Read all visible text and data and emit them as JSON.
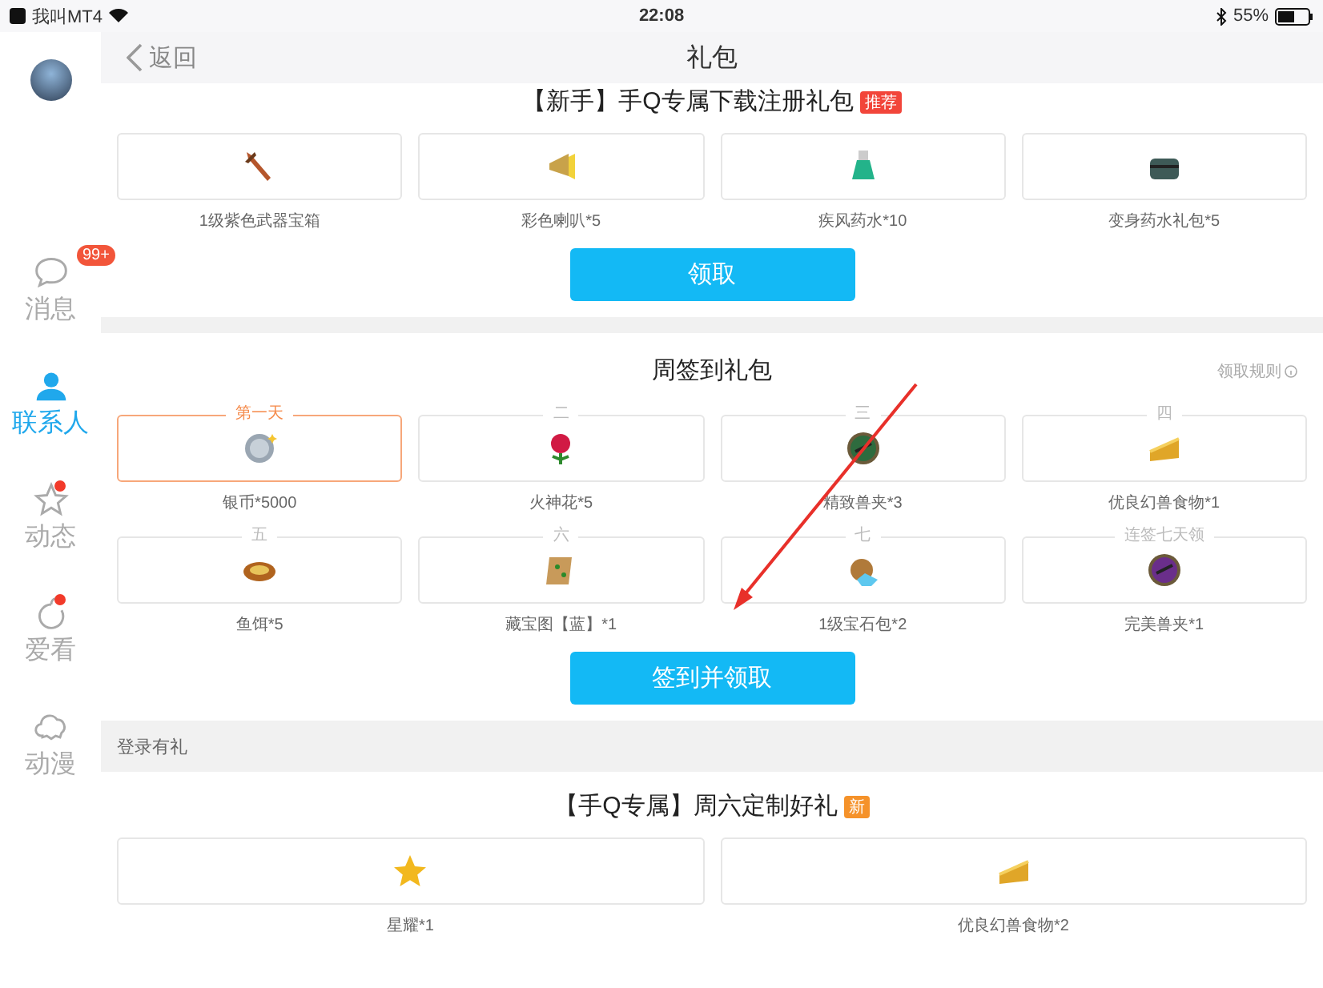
{
  "status_bar": {
    "back_app": "我叫MT4",
    "time": "22:08",
    "battery": "55%"
  },
  "sidebar": {
    "items": [
      {
        "label": "消息",
        "selected": false,
        "badge": "99+",
        "dot": false
      },
      {
        "label": "联系人",
        "selected": true,
        "dot": false
      },
      {
        "label": "动态",
        "selected": false,
        "dot": true
      },
      {
        "label": "爱看",
        "selected": false,
        "dot": true
      },
      {
        "label": "动漫",
        "selected": false,
        "dot": false
      }
    ]
  },
  "nav": {
    "back": "返回",
    "title": "礼包"
  },
  "newbie_pack": {
    "title": "【新手】手Q专属下载注册礼包",
    "tag": "推荐",
    "rewards": [
      {
        "name": "1级紫色武器宝箱"
      },
      {
        "name": "彩色喇叭*5"
      },
      {
        "name": "疾风药水*10"
      },
      {
        "name": "变身药水礼包*5"
      }
    ],
    "button": "领取"
  },
  "weekly_pack": {
    "title": "周签到礼包",
    "rules_link": "领取规则",
    "rewards": [
      {
        "day": "第一天",
        "name": "银币*5000",
        "selected": true
      },
      {
        "day": "二",
        "name": "火神花*5",
        "selected": false
      },
      {
        "day": "三",
        "name": "精致兽夹*3",
        "selected": false
      },
      {
        "day": "四",
        "name": "优良幻兽食物*1",
        "selected": false
      },
      {
        "day": "五",
        "name": "鱼饵*5",
        "selected": false
      },
      {
        "day": "六",
        "name": "藏宝图【蓝】*1",
        "selected": false
      },
      {
        "day": "七",
        "name": "1级宝石包*2",
        "selected": false
      },
      {
        "day": "连签七天领",
        "name": "完美兽夹*1",
        "selected": false
      }
    ],
    "button": "签到并领取"
  },
  "login_section": {
    "header": "登录有礼"
  },
  "saturday_pack": {
    "title": "【手Q专属】周六定制好礼",
    "tag": "新",
    "rewards": [
      {
        "name": "星耀*1"
      },
      {
        "name": "优良幻兽食物*2"
      }
    ]
  }
}
